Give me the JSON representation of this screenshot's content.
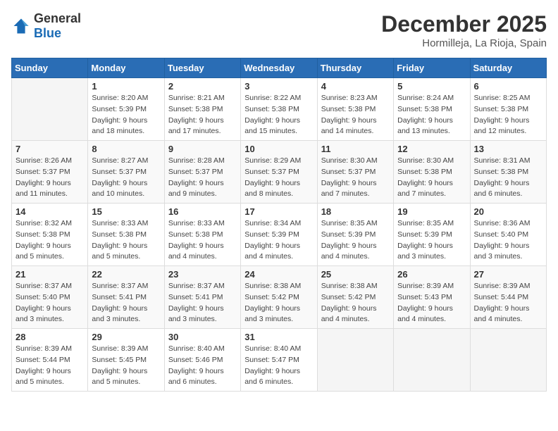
{
  "logo": {
    "general": "General",
    "blue": "Blue"
  },
  "header": {
    "month": "December 2025",
    "location": "Hormilleja, La Rioja, Spain"
  },
  "days_of_week": [
    "Sunday",
    "Monday",
    "Tuesday",
    "Wednesday",
    "Thursday",
    "Friday",
    "Saturday"
  ],
  "weeks": [
    [
      {
        "day": "",
        "sunrise": "",
        "sunset": "",
        "daylight": ""
      },
      {
        "day": "1",
        "sunrise": "Sunrise: 8:20 AM",
        "sunset": "Sunset: 5:39 PM",
        "daylight": "Daylight: 9 hours and 18 minutes."
      },
      {
        "day": "2",
        "sunrise": "Sunrise: 8:21 AM",
        "sunset": "Sunset: 5:38 PM",
        "daylight": "Daylight: 9 hours and 17 minutes."
      },
      {
        "day": "3",
        "sunrise": "Sunrise: 8:22 AM",
        "sunset": "Sunset: 5:38 PM",
        "daylight": "Daylight: 9 hours and 15 minutes."
      },
      {
        "day": "4",
        "sunrise": "Sunrise: 8:23 AM",
        "sunset": "Sunset: 5:38 PM",
        "daylight": "Daylight: 9 hours and 14 minutes."
      },
      {
        "day": "5",
        "sunrise": "Sunrise: 8:24 AM",
        "sunset": "Sunset: 5:38 PM",
        "daylight": "Daylight: 9 hours and 13 minutes."
      },
      {
        "day": "6",
        "sunrise": "Sunrise: 8:25 AM",
        "sunset": "Sunset: 5:38 PM",
        "daylight": "Daylight: 9 hours and 12 minutes."
      }
    ],
    [
      {
        "day": "7",
        "sunrise": "Sunrise: 8:26 AM",
        "sunset": "Sunset: 5:37 PM",
        "daylight": "Daylight: 9 hours and 11 minutes."
      },
      {
        "day": "8",
        "sunrise": "Sunrise: 8:27 AM",
        "sunset": "Sunset: 5:37 PM",
        "daylight": "Daylight: 9 hours and 10 minutes."
      },
      {
        "day": "9",
        "sunrise": "Sunrise: 8:28 AM",
        "sunset": "Sunset: 5:37 PM",
        "daylight": "Daylight: 9 hours and 9 minutes."
      },
      {
        "day": "10",
        "sunrise": "Sunrise: 8:29 AM",
        "sunset": "Sunset: 5:37 PM",
        "daylight": "Daylight: 9 hours and 8 minutes."
      },
      {
        "day": "11",
        "sunrise": "Sunrise: 8:30 AM",
        "sunset": "Sunset: 5:37 PM",
        "daylight": "Daylight: 9 hours and 7 minutes."
      },
      {
        "day": "12",
        "sunrise": "Sunrise: 8:30 AM",
        "sunset": "Sunset: 5:38 PM",
        "daylight": "Daylight: 9 hours and 7 minutes."
      },
      {
        "day": "13",
        "sunrise": "Sunrise: 8:31 AM",
        "sunset": "Sunset: 5:38 PM",
        "daylight": "Daylight: 9 hours and 6 minutes."
      }
    ],
    [
      {
        "day": "14",
        "sunrise": "Sunrise: 8:32 AM",
        "sunset": "Sunset: 5:38 PM",
        "daylight": "Daylight: 9 hours and 5 minutes."
      },
      {
        "day": "15",
        "sunrise": "Sunrise: 8:33 AM",
        "sunset": "Sunset: 5:38 PM",
        "daylight": "Daylight: 9 hours and 5 minutes."
      },
      {
        "day": "16",
        "sunrise": "Sunrise: 8:33 AM",
        "sunset": "Sunset: 5:38 PM",
        "daylight": "Daylight: 9 hours and 4 minutes."
      },
      {
        "day": "17",
        "sunrise": "Sunrise: 8:34 AM",
        "sunset": "Sunset: 5:39 PM",
        "daylight": "Daylight: 9 hours and 4 minutes."
      },
      {
        "day": "18",
        "sunrise": "Sunrise: 8:35 AM",
        "sunset": "Sunset: 5:39 PM",
        "daylight": "Daylight: 9 hours and 4 minutes."
      },
      {
        "day": "19",
        "sunrise": "Sunrise: 8:35 AM",
        "sunset": "Sunset: 5:39 PM",
        "daylight": "Daylight: 9 hours and 3 minutes."
      },
      {
        "day": "20",
        "sunrise": "Sunrise: 8:36 AM",
        "sunset": "Sunset: 5:40 PM",
        "daylight": "Daylight: 9 hours and 3 minutes."
      }
    ],
    [
      {
        "day": "21",
        "sunrise": "Sunrise: 8:37 AM",
        "sunset": "Sunset: 5:40 PM",
        "daylight": "Daylight: 9 hours and 3 minutes."
      },
      {
        "day": "22",
        "sunrise": "Sunrise: 8:37 AM",
        "sunset": "Sunset: 5:41 PM",
        "daylight": "Daylight: 9 hours and 3 minutes."
      },
      {
        "day": "23",
        "sunrise": "Sunrise: 8:37 AM",
        "sunset": "Sunset: 5:41 PM",
        "daylight": "Daylight: 9 hours and 3 minutes."
      },
      {
        "day": "24",
        "sunrise": "Sunrise: 8:38 AM",
        "sunset": "Sunset: 5:42 PM",
        "daylight": "Daylight: 9 hours and 3 minutes."
      },
      {
        "day": "25",
        "sunrise": "Sunrise: 8:38 AM",
        "sunset": "Sunset: 5:42 PM",
        "daylight": "Daylight: 9 hours and 4 minutes."
      },
      {
        "day": "26",
        "sunrise": "Sunrise: 8:39 AM",
        "sunset": "Sunset: 5:43 PM",
        "daylight": "Daylight: 9 hours and 4 minutes."
      },
      {
        "day": "27",
        "sunrise": "Sunrise: 8:39 AM",
        "sunset": "Sunset: 5:44 PM",
        "daylight": "Daylight: 9 hours and 4 minutes."
      }
    ],
    [
      {
        "day": "28",
        "sunrise": "Sunrise: 8:39 AM",
        "sunset": "Sunset: 5:44 PM",
        "daylight": "Daylight: 9 hours and 5 minutes."
      },
      {
        "day": "29",
        "sunrise": "Sunrise: 8:39 AM",
        "sunset": "Sunset: 5:45 PM",
        "daylight": "Daylight: 9 hours and 5 minutes."
      },
      {
        "day": "30",
        "sunrise": "Sunrise: 8:40 AM",
        "sunset": "Sunset: 5:46 PM",
        "daylight": "Daylight: 9 hours and 6 minutes."
      },
      {
        "day": "31",
        "sunrise": "Sunrise: 8:40 AM",
        "sunset": "Sunset: 5:47 PM",
        "daylight": "Daylight: 9 hours and 6 minutes."
      },
      {
        "day": "",
        "sunrise": "",
        "sunset": "",
        "daylight": ""
      },
      {
        "day": "",
        "sunrise": "",
        "sunset": "",
        "daylight": ""
      },
      {
        "day": "",
        "sunrise": "",
        "sunset": "",
        "daylight": ""
      }
    ]
  ]
}
